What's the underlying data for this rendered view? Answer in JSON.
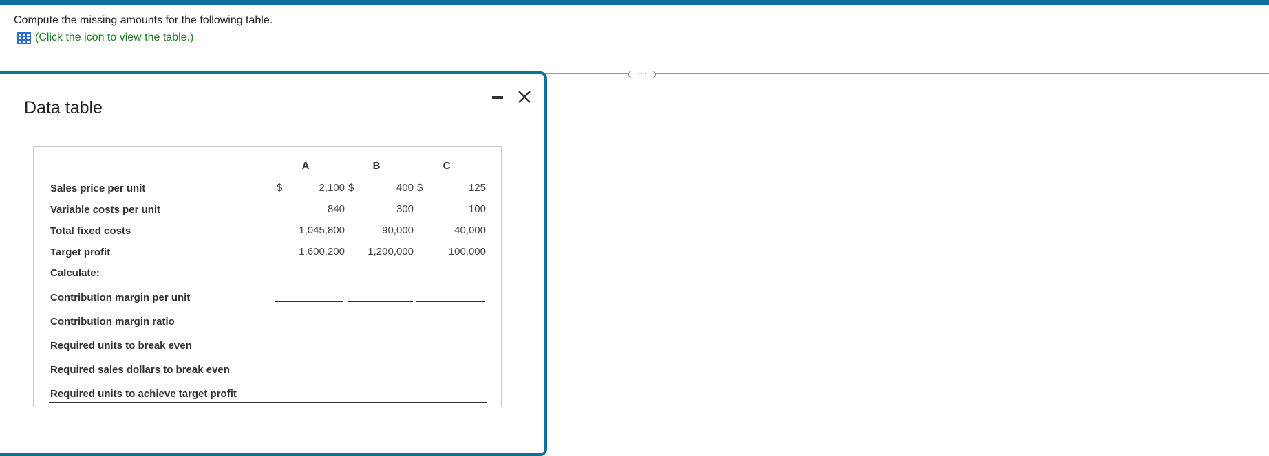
{
  "question": {
    "prompt": "Compute the missing amounts for the following table.",
    "view_link": "(Click the icon to view the table.)"
  },
  "more_button": "···",
  "dialog": {
    "title": "Data table"
  },
  "table": {
    "columns": [
      "A",
      "B",
      "C"
    ],
    "dollar_sign": "$",
    "rows": [
      {
        "label": "Sales price per unit",
        "values": [
          "2,100",
          "400",
          "125"
        ]
      },
      {
        "label": "Variable costs per unit",
        "values": [
          "840",
          "300",
          "100"
        ]
      },
      {
        "label": "Total fixed costs",
        "values": [
          "1,045,800",
          "90,000",
          "40,000"
        ]
      },
      {
        "label": "Target profit",
        "values": [
          "1,600,200",
          "1,200,000",
          "100,000"
        ]
      }
    ],
    "calculate_label": "Calculate:",
    "calc_rows": [
      "Contribution margin per unit",
      "Contribution margin ratio",
      "Required units to break even",
      "Required sales dollars to break even",
      "Required units to achieve target profit"
    ]
  },
  "colors": {
    "accent": "#0a7399",
    "link": "#1b7d1b",
    "icon_blue": "#2a6fd0"
  },
  "icons": [
    "table-icon",
    "minimize-icon",
    "close-icon",
    "more-icon"
  ]
}
